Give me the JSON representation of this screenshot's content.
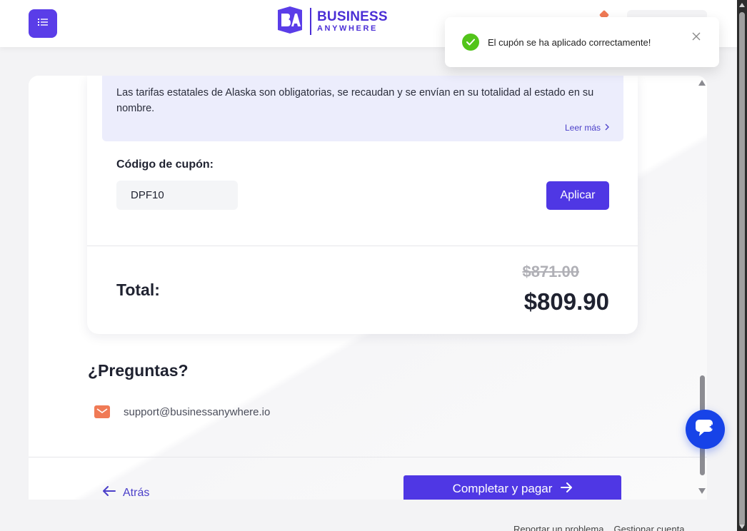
{
  "header": {
    "menu_icon": "list-icon",
    "logo": {
      "line1": "BUSINESS",
      "line2": "ANYWHERE",
      "mark": "BA"
    }
  },
  "toast": {
    "message": "El cupón se ha aplicado correctamente!",
    "status_icon": "check-circle-icon",
    "close_icon": "close-icon"
  },
  "info": {
    "text": "Las tarifas estatales de Alaska son obligatorias, se recaudan y se envían en su totalidad al estado en su nombre.",
    "read_more": "Leer más"
  },
  "coupon": {
    "label": "Código de cupón:",
    "value": "DPF10",
    "apply_label": "Aplicar"
  },
  "total": {
    "label": "Total:",
    "original_price": "$871.00",
    "final_price": "$809.90"
  },
  "questions": {
    "title": "¿Preguntas?",
    "email": "support@businessanywhere.io"
  },
  "nav": {
    "back_label": "Atrás",
    "pay_label": "Completar y pagar"
  },
  "footer": {
    "report": "Reportar un problema",
    "manage": "Gestionar cuenta"
  },
  "colors": {
    "brand": "#4f37e4",
    "success": "#52c41a",
    "accent": "#f07a55",
    "chat": "#1743e8"
  }
}
